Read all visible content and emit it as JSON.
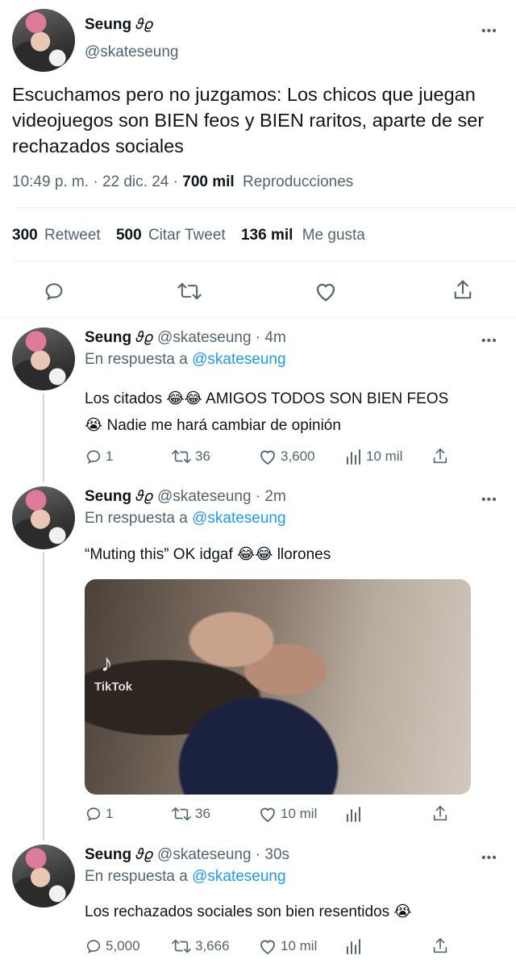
{
  "main_tweet": {
    "display_name": "Seung",
    "name_emoji": "𝜗𝜚",
    "handle": "@skateseung",
    "text": "Escuchamos pero no juzgamos: Los chicos que juegan videojuegos son BIEN feos y BIEN raritos, aparte de ser rechazados sociales",
    "time": "10:49 p. m.",
    "date": "22 dic. 24",
    "views_count": "700 mil",
    "views_label": "Reproducciones",
    "retweets_count": "300",
    "retweets_label": "Retweet",
    "quotes_count": "500",
    "quotes_label": "Citar Tweet",
    "likes_count": "136 mil",
    "likes_label": "Me gusta",
    "more_label": "•••"
  },
  "replies": [
    {
      "display_name": "Seung",
      "name_emoji": "𝜗𝜚",
      "handle": "@skateseung",
      "time_ago": "· 4m",
      "reply_prefix": "En respuesta a",
      "reply_to": "@skateseung",
      "text_line1": "Los citados 😂😂  AMIGOS TODOS SON BIEN FEOS",
      "text_line2": "😭  Nadie me hará cambiar de opinión",
      "replies": "1",
      "retweets": "36",
      "likes": "3,600",
      "views": "10 mil",
      "more_label": "•••"
    },
    {
      "display_name": "Seung",
      "name_emoji": "𝜗𝜚",
      "handle": "@skateseung",
      "time_ago": "· 2m",
      "reply_prefix": "En respuesta a",
      "reply_to": "@skateseung",
      "text_line1": "“Muting this” OK idgaf 😂😂  llorones",
      "media_watermark": "TikTok",
      "replies": "1",
      "retweets": "36",
      "likes": "10 mil",
      "views": "",
      "more_label": "•••"
    },
    {
      "display_name": "Seung",
      "name_emoji": "𝜗𝜚",
      "handle": "@skateseung",
      "time_ago": "· 30s",
      "reply_prefix": "En respuesta a",
      "reply_to": "@skateseung",
      "text_line1": "Los rechazados sociales son bien resentidos 😭",
      "replies": "5,000",
      "retweets": "3,666",
      "likes": "10 mil",
      "views": "",
      "more_label": "•••"
    }
  ]
}
